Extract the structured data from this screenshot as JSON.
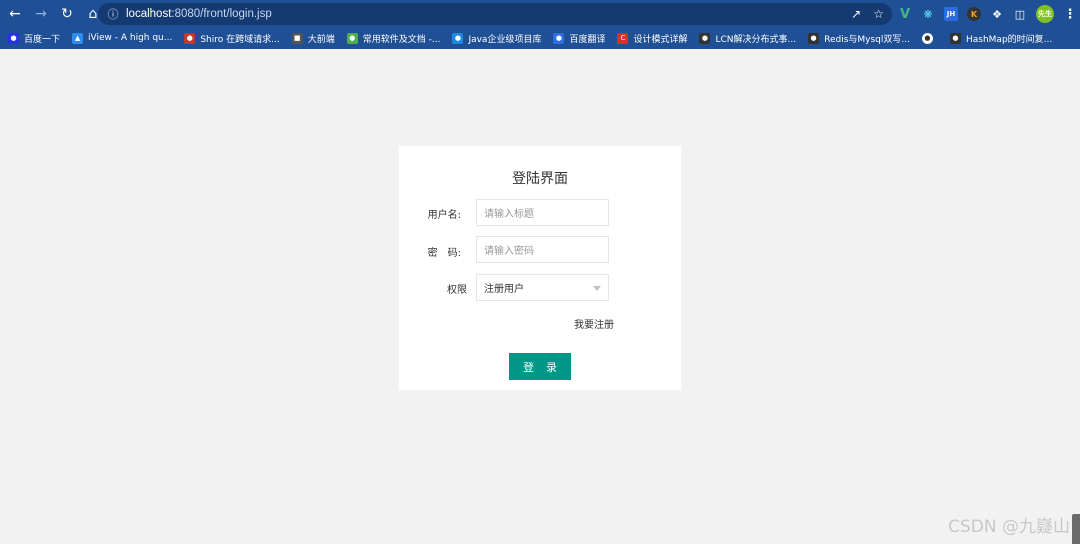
{
  "browser": {
    "url_host": "localhost",
    "url_path": ":8080/front/login.jsp",
    "bookmarks": [
      {
        "label": "百度一下",
        "color": "#2932e1"
      },
      {
        "label": "iView - A high qu...",
        "color": "#2d8cf0"
      },
      {
        "label": "Shiro 在跨域请求...",
        "color": "#c0392b"
      },
      {
        "label": "大前端",
        "color": "#555555"
      },
      {
        "label": "常用软件及文档 -...",
        "color": "#4caf50"
      },
      {
        "label": "Java企业级项目库",
        "color": "#1e88e5"
      },
      {
        "label": "百度翻译",
        "color": "#2f6fe4"
      },
      {
        "label": "设计模式详解",
        "color": "#d9302f"
      },
      {
        "label": "LCN解决分布式事...",
        "color": "#333333"
      },
      {
        "label": "Redis与Mysql双写...",
        "color": "#333333"
      },
      {
        "label": "",
        "color": "#ffffff"
      },
      {
        "label": "HashMap的时间复...",
        "color": "#333333"
      }
    ],
    "ext_avatar": "先生"
  },
  "login": {
    "title": "登陆界面",
    "username_label": "用户名:",
    "username_placeholder": "请输入标题",
    "password_label": "密　码:",
    "password_placeholder": "请输入密码",
    "role_label": "权限",
    "role_selected": "注册用户",
    "register_link": "我要注册",
    "login_button": "登录"
  },
  "watermark": "CSDN @九嶷山",
  "colors": {
    "primary": "#009688",
    "chrome": "#1f4f94"
  }
}
